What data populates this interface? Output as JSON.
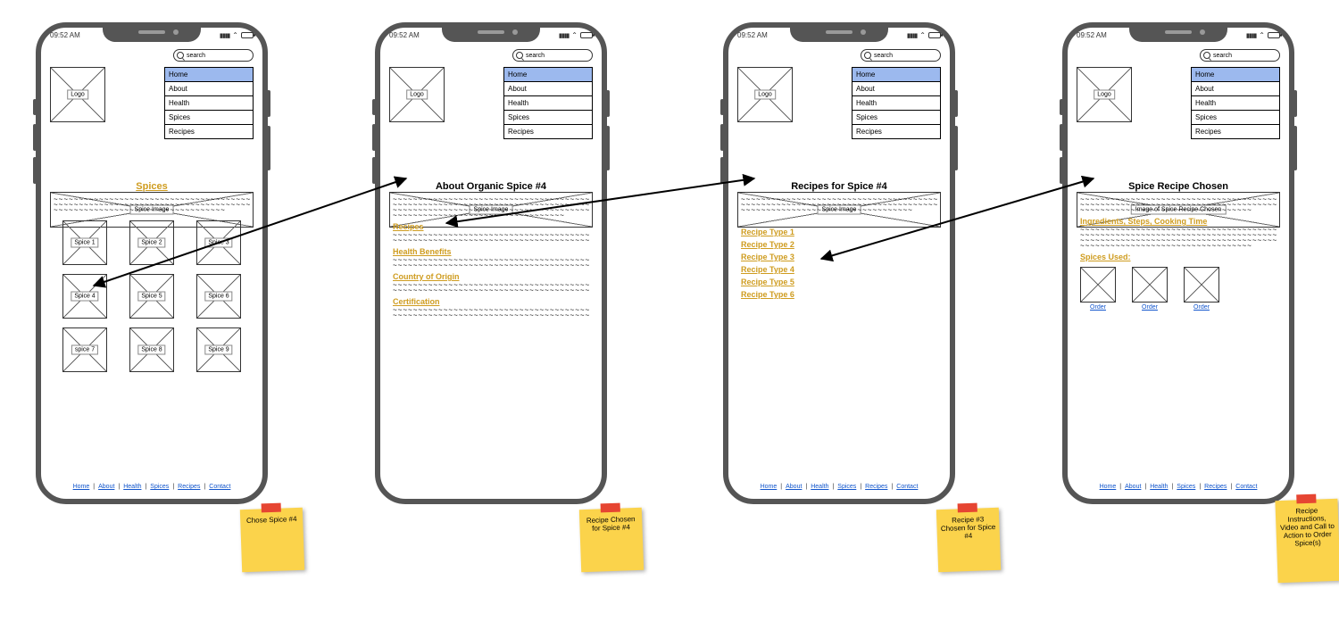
{
  "status": {
    "time": "09:52 AM"
  },
  "search": {
    "placeholder": "search"
  },
  "logo_label": "Logo",
  "nav": [
    "Home",
    "About",
    "Health",
    "Spices",
    "Recipes"
  ],
  "nav_active_index": 0,
  "hero_label": "Spice Image",
  "hero_label_recipe": "Image of Spice Recipe Chosen",
  "footer": [
    "Home",
    "About",
    "Health",
    "Spices",
    "Recipes",
    "Contact"
  ],
  "screen1": {
    "heading": "Spices",
    "tiles": [
      "Spice 1",
      "Spice 2",
      "Spice 3",
      "Spice 4",
      "Spice 5",
      "Spice 6",
      "spice 7",
      "Spice 8",
      "Spice 9"
    ]
  },
  "screen2": {
    "heading": "About Organic Spice #4",
    "sections": [
      "Recipes",
      "Health Benefits",
      "Country of Origin",
      "Certification"
    ]
  },
  "screen3": {
    "heading": "Recipes for Spice #4",
    "links": [
      "Recipe Type 1",
      "Recipe Type 2",
      "Recipe Type 3",
      "Recipe Type 4",
      "Recipe Type 5",
      "Recipe Type 6"
    ]
  },
  "screen4": {
    "heading": "Spice Recipe Chosen",
    "section1": "Ingredients, Steps, Cooking Time",
    "section2": "Spices Used:",
    "order": "Order"
  },
  "stickies": {
    "s1": "Chose Spice #4",
    "s2": "Recipe Chosen for Spice #4",
    "s3": "Recipe #3 Chosen for Spice #4",
    "s4": "Recipe Instructions, Video and Call to Action to Order Spice(s)"
  }
}
